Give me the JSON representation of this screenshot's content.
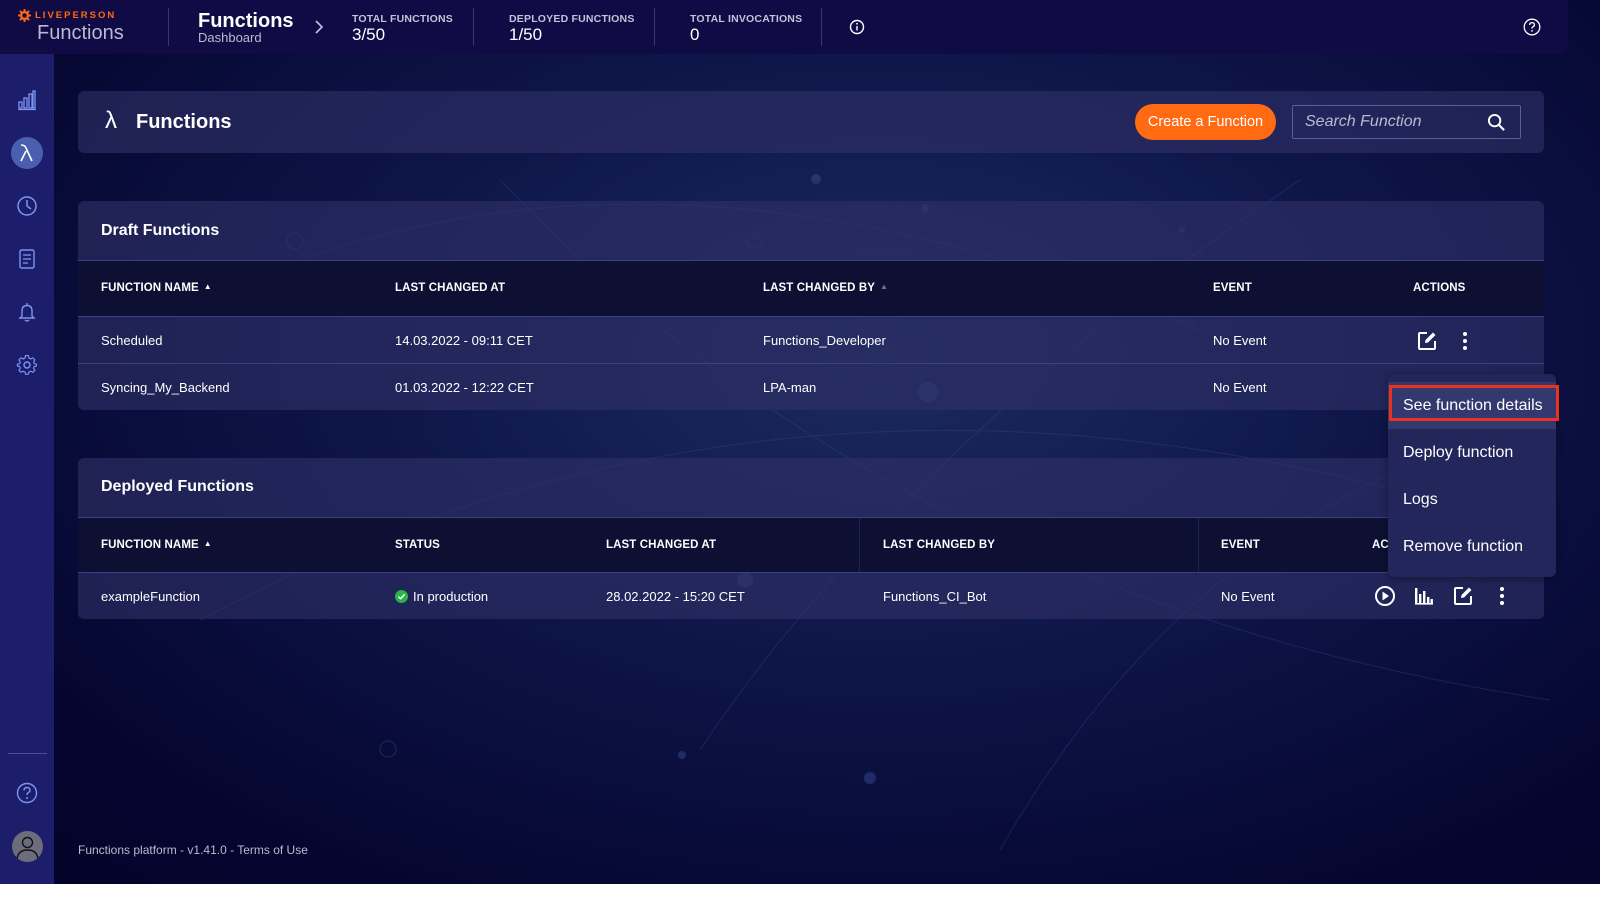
{
  "brand": {
    "company": "LIVEPERSON",
    "product": "Functions",
    "accent_color": "#ff6a13"
  },
  "breadcrumb": {
    "title": "Functions",
    "subtitle": "Dashboard"
  },
  "stats": [
    {
      "label": "TOTAL FUNCTIONS",
      "value": "3/50"
    },
    {
      "label": "DEPLOYED FUNCTIONS",
      "value": "1/50"
    },
    {
      "label": "TOTAL INVOCATIONS",
      "value": "0"
    }
  ],
  "topbar_icons": [
    "info-icon",
    "help-icon"
  ],
  "sidebar": {
    "items": [
      {
        "name": "analytics",
        "icon": "bar-chart-icon",
        "active": false
      },
      {
        "name": "functions",
        "icon": "lambda-icon",
        "active": true
      },
      {
        "name": "schedules",
        "icon": "clock-icon",
        "active": false
      },
      {
        "name": "documents",
        "icon": "document-icon",
        "active": false
      },
      {
        "name": "alerts",
        "icon": "bell-icon",
        "active": false
      },
      {
        "name": "settings",
        "icon": "gear-icon",
        "active": false
      }
    ],
    "bottom": [
      {
        "name": "help",
        "icon": "help-icon"
      },
      {
        "name": "profile",
        "icon": "avatar-icon"
      }
    ]
  },
  "header": {
    "lambda": "λ",
    "title": "Functions",
    "create_button": "Create a Function",
    "search_placeholder": "Search Function",
    "search_value": ""
  },
  "draft": {
    "title": "Draft Functions",
    "columns": [
      "FUNCTION NAME",
      "LAST CHANGED AT",
      "LAST CHANGED BY",
      "EVENT",
      "ACTIONS"
    ],
    "sort_marker": "▲",
    "rows": [
      {
        "name": "Scheduled",
        "changed_at": "14.03.2022 - 09:11 CET",
        "changed_by": "Functions_Developer",
        "event": "No Event"
      },
      {
        "name": "Syncing_My_Backend",
        "changed_at": "01.03.2022 - 12:22 CET",
        "changed_by": "LPA-man",
        "event": "No Event"
      }
    ]
  },
  "deployed": {
    "title": "Deployed Functions",
    "columns": [
      "FUNCTION NAME",
      "STATUS",
      "LAST CHANGED AT",
      "LAST CHANGED BY",
      "EVENT",
      "ACTIONS"
    ],
    "actions_visible_label": "AC",
    "rows": [
      {
        "name": "exampleFunction",
        "status": "In production",
        "status_color": "#2bb24c",
        "changed_at": "28.02.2022 - 15:20 CET",
        "changed_by": "Functions_CI_Bot",
        "event": "No Event"
      }
    ]
  },
  "context_menu": {
    "items": [
      {
        "label": "See function details",
        "highlighted": true
      },
      {
        "label": "Deploy function"
      },
      {
        "label": "Logs"
      },
      {
        "label": "Remove function"
      }
    ],
    "highlight_outline_color": "#e8311f"
  },
  "footer": {
    "platform": "Functions platform",
    "separator": " - ",
    "version": "v1.41.0",
    "terms": "Terms of Use"
  }
}
